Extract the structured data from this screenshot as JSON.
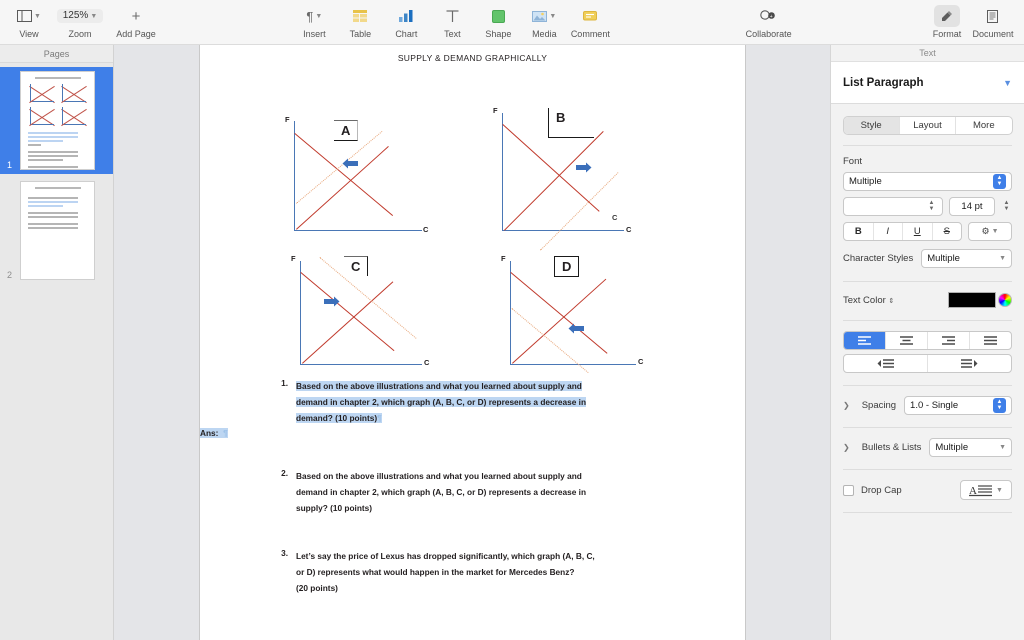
{
  "toolbar": {
    "left_items": [
      {
        "name": "view",
        "label": "View",
        "icon": "panel-icon",
        "caret": true
      },
      {
        "name": "zoom",
        "label": "Zoom",
        "icon": "zoom-value",
        "value": "125%",
        "caret": true
      },
      {
        "name": "add-page",
        "label": "Add Page",
        "icon": "plus-icon",
        "caret": false
      }
    ],
    "center_items": [
      {
        "name": "insert",
        "label": "Insert",
        "icon": "pilcrow-icon",
        "caret": true
      },
      {
        "name": "table",
        "label": "Table",
        "icon": "table-icon",
        "caret": false
      },
      {
        "name": "chart",
        "label": "Chart",
        "icon": "chart-icon",
        "caret": false
      },
      {
        "name": "text",
        "label": "Text",
        "icon": "text-t-icon",
        "caret": false
      },
      {
        "name": "shape",
        "label": "Shape",
        "icon": "shape-square-icon",
        "caret": false
      },
      {
        "name": "media",
        "label": "Media",
        "icon": "media-image-icon",
        "caret": true
      },
      {
        "name": "comment",
        "label": "Comment",
        "icon": "comment-icon",
        "caret": false
      }
    ],
    "collaborate": {
      "label": "Collaborate",
      "icon": "collaborate-icon"
    },
    "right_items": [
      {
        "name": "format",
        "label": "Format",
        "icon": "format-brush-icon",
        "active": true
      },
      {
        "name": "document",
        "label": "Document",
        "icon": "document-icon",
        "active": false
      }
    ]
  },
  "sidebar": {
    "header": "Pages",
    "pages": [
      {
        "number": "1",
        "selected": true
      },
      {
        "number": "2",
        "selected": false
      }
    ]
  },
  "document": {
    "title": "SUPPLY & DEMAND GRAPHICALLY",
    "graphs": [
      {
        "label": "A",
        "y_axis": "F",
        "x_axis": "C",
        "arrow": "left"
      },
      {
        "label": "B",
        "y_axis": "F",
        "x_axis": "C",
        "arrow": "right",
        "extra_x": "C"
      },
      {
        "label": "C",
        "y_axis": "F",
        "x_axis": "C",
        "arrow": "right"
      },
      {
        "label": "D",
        "y_axis": "F",
        "x_axis": "C",
        "arrow": "left"
      }
    ],
    "questions": [
      {
        "number": "1.",
        "selected": true,
        "lines": [
          "Based on the above illustrations and what you learned about supply and",
          "demand in chapter 2, which graph (A, B, C, or D) represents a decrease in",
          "demand? (10 points)"
        ],
        "answer_label": "Ans:"
      },
      {
        "number": "2.",
        "selected": false,
        "lines": [
          "Based on the above illustrations and what you learned about supply and",
          "demand in chapter 2, which graph (A, B, C, or D) represents a decrease in",
          "supply? (10 points)"
        ]
      },
      {
        "number": "3.",
        "selected": false,
        "lines": [
          "Let’s say the price of Lexus has dropped significantly, which graph (A, B, C,",
          "or D) represents what would happen in the market for Mercedes Benz?",
          "(20 points)"
        ]
      }
    ]
  },
  "inspector": {
    "panel_title": "Text",
    "style_name": "List Paragraph",
    "tabs": [
      {
        "label": "Style",
        "active": true
      },
      {
        "label": "Layout",
        "active": false
      },
      {
        "label": "More",
        "active": false
      }
    ],
    "font": {
      "section_label": "Font",
      "family_value": "Multiple",
      "typeface_value": "",
      "size_value": "14 pt",
      "style_buttons": [
        "B",
        "I",
        "U",
        "S"
      ],
      "gear_label": "⚙",
      "character_styles_label": "Character Styles",
      "character_styles_value": "Multiple"
    },
    "text_color": {
      "label": "Text Color",
      "swatch_hex": "#000000"
    },
    "alignment": {
      "buttons": [
        "align-left",
        "align-center",
        "align-right",
        "align-justify"
      ],
      "active_index": 0,
      "indent_buttons": [
        "decrease-indent",
        "increase-indent"
      ]
    },
    "spacing": {
      "label": "Spacing",
      "value": "1.0 - Single"
    },
    "bullets": {
      "label": "Bullets & Lists",
      "value": "Multiple"
    },
    "drop_cap": {
      "label": "Drop Cap",
      "checked": false
    }
  },
  "colors": {
    "accent_blue": "#3f7fe8",
    "selection_blue": "#bdd6f2",
    "axis_blue": "#4a77b5",
    "curve_red": "#c0392b",
    "curve_orange": "#e8a87c"
  }
}
